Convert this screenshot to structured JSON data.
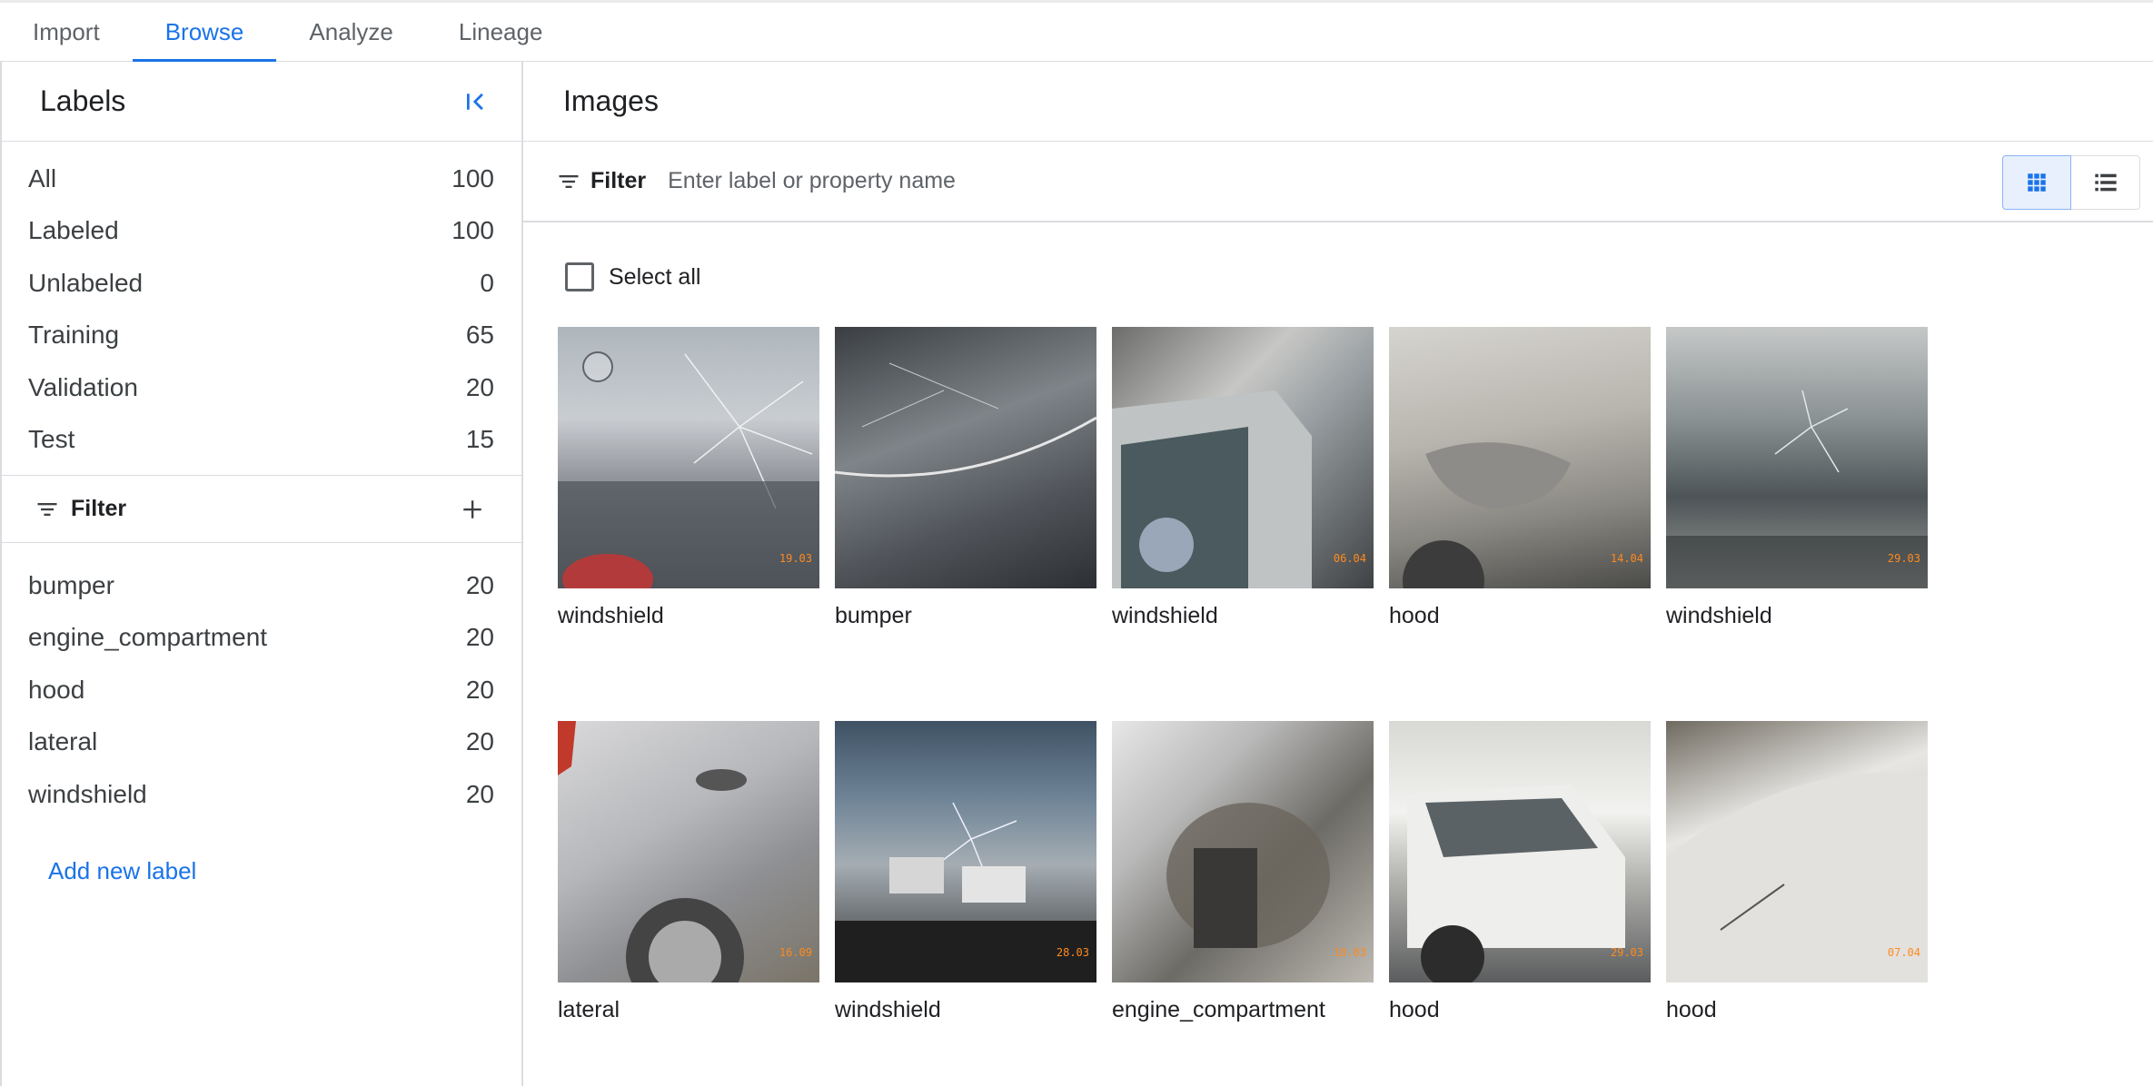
{
  "tabs": [
    "Import",
    "Browse",
    "Analyze",
    "Lineage"
  ],
  "active_tab": "Browse",
  "labels_panel": {
    "title": "Labels",
    "counts": [
      {
        "label": "All",
        "value": "100"
      },
      {
        "label": "Labeled",
        "value": "100"
      },
      {
        "label": "Unlabeled",
        "value": "0"
      },
      {
        "label": "Training",
        "value": "65"
      },
      {
        "label": "Validation",
        "value": "20"
      },
      {
        "label": "Test",
        "value": "15"
      }
    ],
    "filter_label": "Filter",
    "labels": [
      {
        "label": "bumper",
        "value": "20"
      },
      {
        "label": "engine_compartment",
        "value": "20"
      },
      {
        "label": "hood",
        "value": "20"
      },
      {
        "label": "lateral",
        "value": "20"
      },
      {
        "label": "windshield",
        "value": "20"
      }
    ],
    "add_label": "Add new label"
  },
  "images_panel": {
    "title": "Images",
    "filter_label": "Filter",
    "filter_placeholder": "Enter label or property name",
    "select_all": "Select all",
    "images": [
      {
        "label": "windshield",
        "stamp": "19.03"
      },
      {
        "label": "bumper",
        "stamp": ""
      },
      {
        "label": "windshield",
        "stamp": "06.04"
      },
      {
        "label": "hood",
        "stamp": "14.04"
      },
      {
        "label": "windshield",
        "stamp": "29.03"
      },
      {
        "label": "lateral",
        "stamp": "16.09"
      },
      {
        "label": "windshield",
        "stamp": "28.03"
      },
      {
        "label": "engine_compartment",
        "stamp": "18.03"
      },
      {
        "label": "hood",
        "stamp": "29.03"
      },
      {
        "label": "hood",
        "stamp": "07.04"
      }
    ]
  },
  "colors": {
    "accent": "#1a73e8",
    "divider": "#dadce0",
    "text": "#202124"
  },
  "icons": [
    "collapse-panel-icon",
    "filter-icon",
    "add-icon",
    "grid-view-icon",
    "list-view-icon"
  ]
}
